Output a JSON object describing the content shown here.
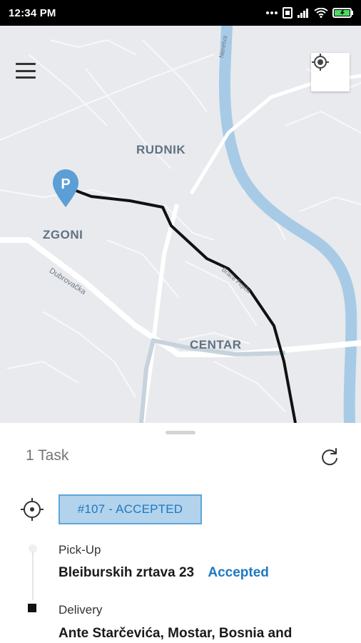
{
  "status_bar": {
    "time": "12:34 PM",
    "battery_color": "#4cd964"
  },
  "map": {
    "districts": [
      "RUDNIK",
      "ZGONI",
      "CENTAR"
    ],
    "streets": [
      "Dubrovačka",
      "Braće Fejića",
      "Neretva"
    ],
    "marker_letter": "P",
    "route_color": "#111111",
    "river_color": "#a7cbe6"
  },
  "toolbar": {
    "menu_icon": "hamburger-menu-icon",
    "locate_icon": "my-location-icon"
  },
  "sheet": {
    "task_count": "1 Task",
    "refresh_icon": "refresh-icon",
    "task_badge": "#107 - ACCEPTED",
    "badge_color": "#b3d3ec",
    "steps": [
      {
        "label": "Pick-Up",
        "address": "Bleiburskih zrtava 23",
        "status": "Accepted"
      },
      {
        "label": "Delivery",
        "address": "Ante Starčevića, Mostar, Bosnia and"
      }
    ]
  }
}
